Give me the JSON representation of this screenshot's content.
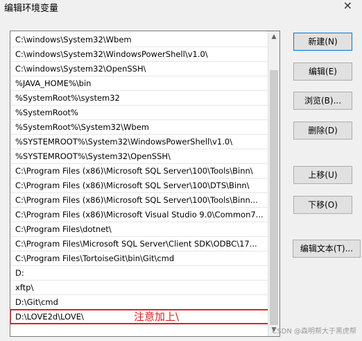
{
  "window": {
    "title": "编辑环境变量",
    "close_glyph": "×"
  },
  "path_list": [
    "C:\\windows\\System32\\Wbem",
    "C:\\windows\\System32\\WindowsPowerShell\\v1.0\\",
    "C:\\windows\\System32\\OpenSSH\\",
    "%JAVA_HOME%\\bin",
    "%SystemRoot%\\system32",
    "%SystemRoot%",
    "%SystemRoot%\\System32\\Wbem",
    "%SYSTEMROOT%\\System32\\WindowsPowerShell\\v1.0\\",
    "%SYSTEMROOT%\\System32\\OpenSSH\\",
    "C:\\Program Files (x86)\\Microsoft SQL Server\\100\\Tools\\Binn\\",
    "C:\\Program Files (x86)\\Microsoft SQL Server\\100\\DTS\\Binn\\",
    "C:\\Program Files (x86)\\Microsoft SQL Server\\100\\Tools\\Binn...",
    "C:\\Program Files (x86)\\Microsoft Visual Studio 9.0\\Common7...",
    "C:\\Program Files\\dotnet\\",
    "C:\\Program Files\\Microsoft SQL Server\\Client SDK\\ODBC\\17...",
    "C:\\Program Files\\TortoiseGit\\bin\\Git\\cmd",
    "D:",
    "xftp\\",
    "D:\\Git\\cmd",
    "D:\\LOVE2d\\LOVE\\"
  ],
  "buttons": {
    "new": "新建(N)",
    "edit": "编辑(E)",
    "browse": "浏览(B)...",
    "delete": "删除(D)",
    "move_up": "上移(U)",
    "move_down": "下移(O)",
    "edit_text": "编辑文本(T)..."
  },
  "annotation": "注意加上\\",
  "watermark": "CSDN @森明帮大于黑虎帮",
  "colors": {
    "annotation_red": "#e02020",
    "default_button_border": "#0078d7"
  }
}
